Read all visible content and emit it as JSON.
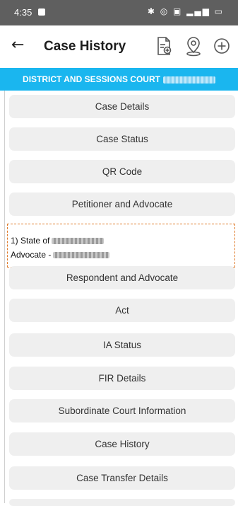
{
  "status_bar": {
    "time": "4:35",
    "icons": "bluetooth wifi 5G signal battery"
  },
  "app_bar": {
    "title": "Case History",
    "back_icon": "back-arrow-icon",
    "actions": [
      "document-add-icon",
      "location-pin-icon",
      "add-circle-icon"
    ]
  },
  "court": {
    "name": "DISTRICT AND SESSIONS COURT"
  },
  "sections": {
    "case_details": "Case Details",
    "case_status": "Case Status",
    "qr_code": "QR Code",
    "petitioner": "Petitioner and Advocate",
    "respondent": "Respondent and Advocate",
    "act": "Act",
    "ia_status": "IA Status",
    "fir_details": "FIR Details",
    "subordinate": "Subordinate Court Information",
    "case_history": "Case History",
    "case_transfer": "Case Transfer Details"
  },
  "petitioner": {
    "line1": "1) State of",
    "line2": "Advocate -"
  },
  "colors": {
    "banner": "#1ab6ef",
    "highlight_border": "#e07b2a",
    "button_bg": "#efefef"
  }
}
